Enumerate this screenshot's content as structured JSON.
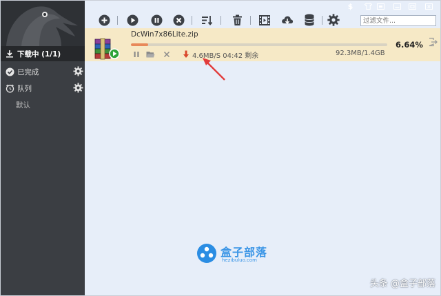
{
  "sidebar": {
    "items": [
      {
        "label": "下载中 (1/1)"
      },
      {
        "label": "已完成"
      },
      {
        "label": "队列"
      },
      {
        "label": "默认"
      }
    ]
  },
  "toolbar": {
    "search_placeholder": "过滤文件...",
    "buttons": [
      "add-icon",
      "play-icon",
      "pause-icon",
      "stop-icon",
      "sort-icon",
      "trash-icon",
      "video-icon",
      "cloud-download-icon",
      "database-icon",
      "gear-icon"
    ]
  },
  "window": {
    "sponsor_symbol": "$"
  },
  "task": {
    "filename": "DcWin7x86Lite.zip",
    "percent": "6.64%",
    "progress": 6.64,
    "speed": "4.6MB/S 04:42 剩余",
    "size": "92.3MB/1.4GB"
  },
  "watermark": {
    "title": "盒子部落",
    "subtitle": "hezibuluo.com"
  },
  "credit": "头条 @盒子部落",
  "colors": {
    "accent": "#e8895a",
    "task_bg": "#f6e9c6",
    "sidebar_bg": "#3b3e43",
    "main_bg": "#e7eef9",
    "annotation": "#e23b3b"
  }
}
